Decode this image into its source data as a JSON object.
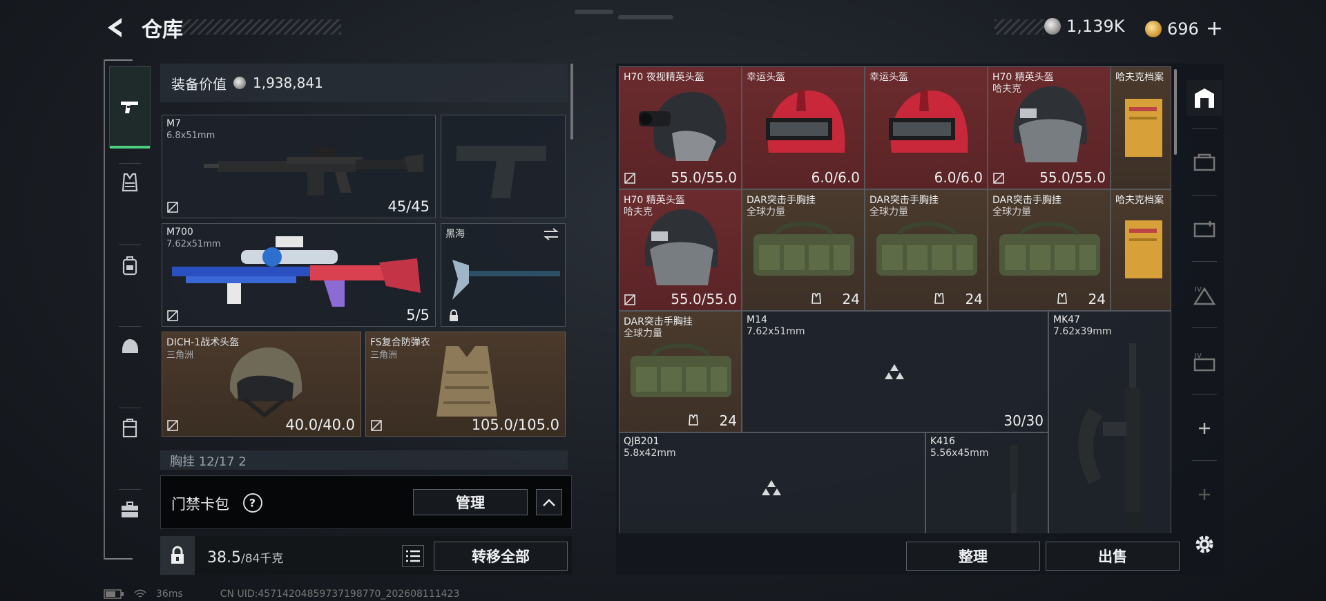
{
  "header": {
    "title": "仓库",
    "currency_silver": "1,139K",
    "currency_gold": "696"
  },
  "left_nav": {
    "items": [
      {
        "icon": "pistol-icon",
        "active": true
      },
      {
        "icon": "vest-icon",
        "active": false
      },
      {
        "icon": "backpack-icon",
        "active": false
      },
      {
        "icon": "helmet-icon",
        "active": false
      },
      {
        "icon": "case-icon",
        "active": false
      },
      {
        "icon": "briefcase-icon",
        "active": false
      }
    ]
  },
  "loadout": {
    "equip_value_label": "装备价值",
    "equip_value": "1,938,841",
    "slots": [
      {
        "name": "M7",
        "sub": "6.8x51mm",
        "count": "45/45"
      },
      {
        "name": "",
        "sub": "",
        "count": ""
      },
      {
        "name": "M700",
        "sub": "7.62x51mm",
        "count": "5/5"
      },
      {
        "name": "黑海",
        "sub": "",
        "count": ""
      },
      {
        "name": "DICH-1战术头盔",
        "sub": "三角洲",
        "count": "40.0/40.0"
      },
      {
        "name": "FS复合防弹衣",
        "sub": "三角洲",
        "count": "105.0/105.0"
      }
    ],
    "partial_row": "胸挂  12/17  2"
  },
  "keycard": {
    "label": "门禁卡包",
    "help": "?",
    "manage_label": "管理"
  },
  "bottom": {
    "weight_value": "38.5",
    "weight_max": "/84千克",
    "transfer_all_label": "转移全部"
  },
  "stash": {
    "items": [
      {
        "name": "H70 夜视精英头盔",
        "sub": "",
        "count": "55.0/55.0",
        "color": "red"
      },
      {
        "name": "幸运头盔",
        "sub": "",
        "count": "6.0/6.0",
        "color": "red"
      },
      {
        "name": "幸运头盔",
        "sub": "",
        "count": "6.0/6.0",
        "color": "red"
      },
      {
        "name": "H70 精英头盔",
        "sub": "哈夫克",
        "count": "55.0/55.0",
        "color": "red"
      },
      {
        "name": "哈夫克档案",
        "sub": "",
        "count": "",
        "color": "brown"
      },
      {
        "name": "H70 精英头盔",
        "sub": "哈夫克",
        "count": "55.0/55.0",
        "color": "red"
      },
      {
        "name": "DAR突击手胸挂",
        "sub": "全球力量",
        "count": "24",
        "color": "brown"
      },
      {
        "name": "DAR突击手胸挂",
        "sub": "全球力量",
        "count": "24",
        "color": "brown"
      },
      {
        "name": "DAR突击手胸挂",
        "sub": "全球力量",
        "count": "24",
        "color": "brown"
      },
      {
        "name": "哈夫克档案",
        "sub": "",
        "count": "",
        "color": "brown"
      },
      {
        "name": "DAR突击手胸挂",
        "sub": "全球力量",
        "count": "24",
        "color": "brown"
      },
      {
        "name": "M14",
        "sub": "7.62x51mm",
        "count": "30/30",
        "color": "dark"
      },
      {
        "name": "MK47",
        "sub": "7.62x39mm",
        "count": "",
        "color": "dark"
      },
      {
        "name": "QJB201",
        "sub": "5.8x42mm",
        "count": "",
        "color": "dark"
      },
      {
        "name": "K416",
        "sub": "5.56x45mm",
        "count": "",
        "color": "dark"
      }
    ],
    "sort_label": "整理",
    "sell_label": "出售"
  },
  "right_nav": {
    "items": [
      "warehouse-icon",
      "stash-page-2-icon",
      "stash-page-3-icon",
      "stash-page-4-icon",
      "stash-page-5-icon",
      "add-page-icon",
      "add-page-icon",
      "settings-icon"
    ]
  },
  "status": {
    "ping": "36ms",
    "uid": "CN UID:45714204859737198770_202608111423"
  },
  "colors": {
    "accent_green": "#4ccf7f",
    "item_red": "#6b2b2e",
    "item_brown": "#4a3a2d"
  }
}
